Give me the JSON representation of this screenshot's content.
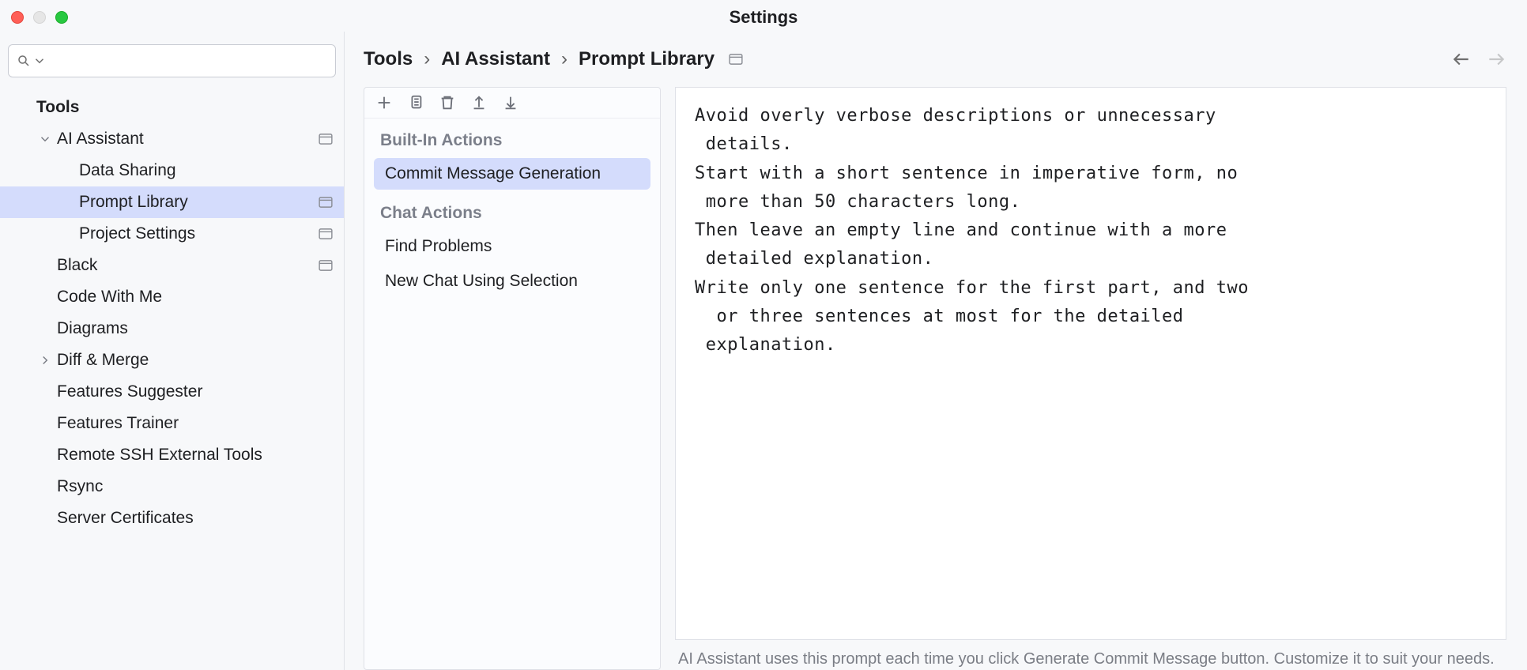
{
  "window": {
    "title": "Settings"
  },
  "search": {
    "placeholder": ""
  },
  "tree": {
    "header": "Tools",
    "items": [
      {
        "label": "AI Assistant",
        "badge": true,
        "caret": "down"
      },
      {
        "label": "Data Sharing"
      },
      {
        "label": "Prompt Library",
        "badge": true,
        "selected": true
      },
      {
        "label": "Project Settings",
        "badge": true
      },
      {
        "label": "Black",
        "badge": true
      },
      {
        "label": "Code With Me"
      },
      {
        "label": "Diagrams"
      },
      {
        "label": "Diff & Merge",
        "caret": "right"
      },
      {
        "label": "Features Suggester"
      },
      {
        "label": "Features Trainer"
      },
      {
        "label": "Remote SSH External Tools"
      },
      {
        "label": "Rsync"
      },
      {
        "label": "Server Certificates"
      }
    ]
  },
  "breadcrumb": [
    "Tools",
    "AI Assistant",
    "Prompt Library"
  ],
  "actions": {
    "sections": [
      {
        "title": "Built-In Actions",
        "items": [
          {
            "label": "Commit Message Generation",
            "selected": true
          }
        ]
      },
      {
        "title": "Chat Actions",
        "items": [
          {
            "label": "Find Problems"
          },
          {
            "label": "New Chat Using Selection"
          }
        ]
      }
    ]
  },
  "editor": {
    "text": "Avoid overly verbose descriptions or unnecessary\n details.\nStart with a short sentence in imperative form, no\n more than 50 characters long.\nThen leave an empty line and continue with a more\n detailed explanation.\nWrite only one sentence for the first part, and two\n  or three sentences at most for the detailed\n explanation."
  },
  "hint": "AI Assistant uses this prompt each time you click Generate Commit Message button. Customize it to suit your needs."
}
